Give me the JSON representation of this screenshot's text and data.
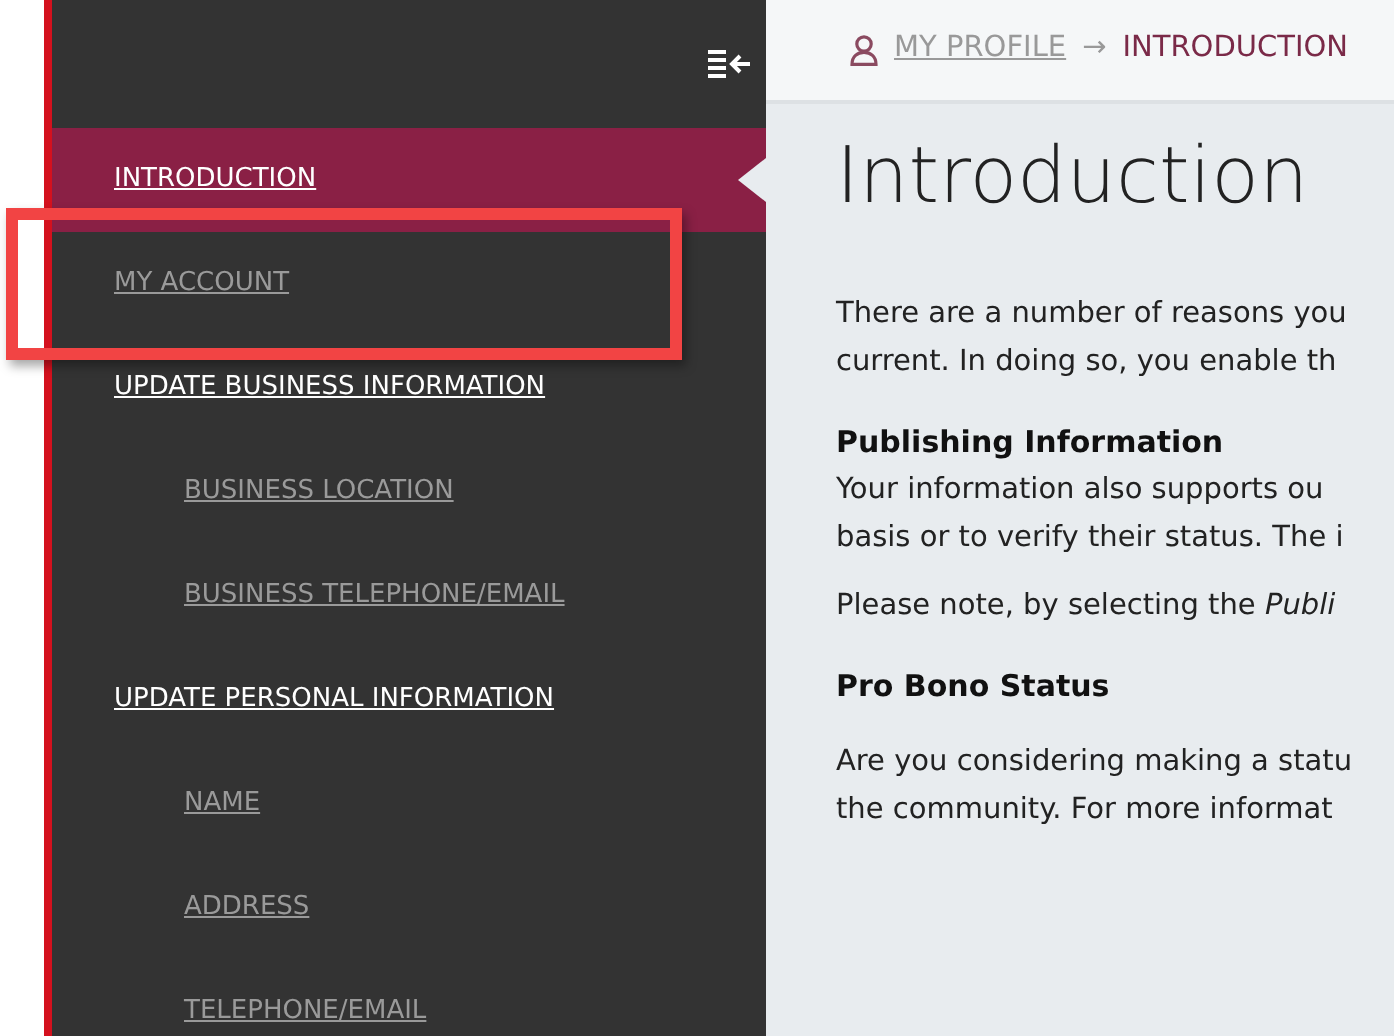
{
  "sidebar": {
    "items": [
      {
        "label": "INTRODUCTION",
        "kind": "heading",
        "selected": true,
        "highlighted": false
      },
      {
        "label": "MY ACCOUNT",
        "kind": "link",
        "selected": false,
        "highlighted": true
      },
      {
        "label": "UPDATE BUSINESS INFORMATION",
        "kind": "heading",
        "selected": false,
        "highlighted": false
      },
      {
        "label": "BUSINESS LOCATION",
        "kind": "sublink",
        "selected": false,
        "highlighted": false
      },
      {
        "label": "BUSINESS TELEPHONE/EMAIL",
        "kind": "sublink",
        "selected": false,
        "highlighted": false
      },
      {
        "label": "UPDATE PERSONAL INFORMATION",
        "kind": "heading",
        "selected": false,
        "highlighted": false
      },
      {
        "label": "NAME",
        "kind": "sublink",
        "selected": false,
        "highlighted": false
      },
      {
        "label": "ADDRESS",
        "kind": "sublink",
        "selected": false,
        "highlighted": false
      },
      {
        "label": "TELEPHONE/EMAIL",
        "kind": "sublink",
        "selected": false,
        "highlighted": false
      }
    ]
  },
  "breadcrumb": [
    {
      "label": "MY PROFILE",
      "current": false
    },
    {
      "label": "INTRODUCTION",
      "current": true
    }
  ],
  "breadcrumb_separator": "→",
  "content": {
    "title": "Introduction",
    "blocks": [
      {
        "kind": "paragraph",
        "lines": [
          "There are a number of reasons you",
          "current. In doing so, you enable th"
        ]
      },
      {
        "kind": "subheading",
        "lines": [
          "Publishing Information"
        ]
      },
      {
        "kind": "paragraph_tight",
        "lines": [
          "Your information also supports ou",
          "basis or to verify their status. The i"
        ]
      },
      {
        "kind": "paragraph",
        "lines": [
          "Please note, by selecting the *Publi*"
        ]
      },
      {
        "kind": "subheading",
        "lines": [
          "Pro Bono Status"
        ]
      },
      {
        "kind": "paragraph",
        "lines": [
          "Are you considering making a statu",
          "the community. For more informat"
        ]
      }
    ]
  }
}
